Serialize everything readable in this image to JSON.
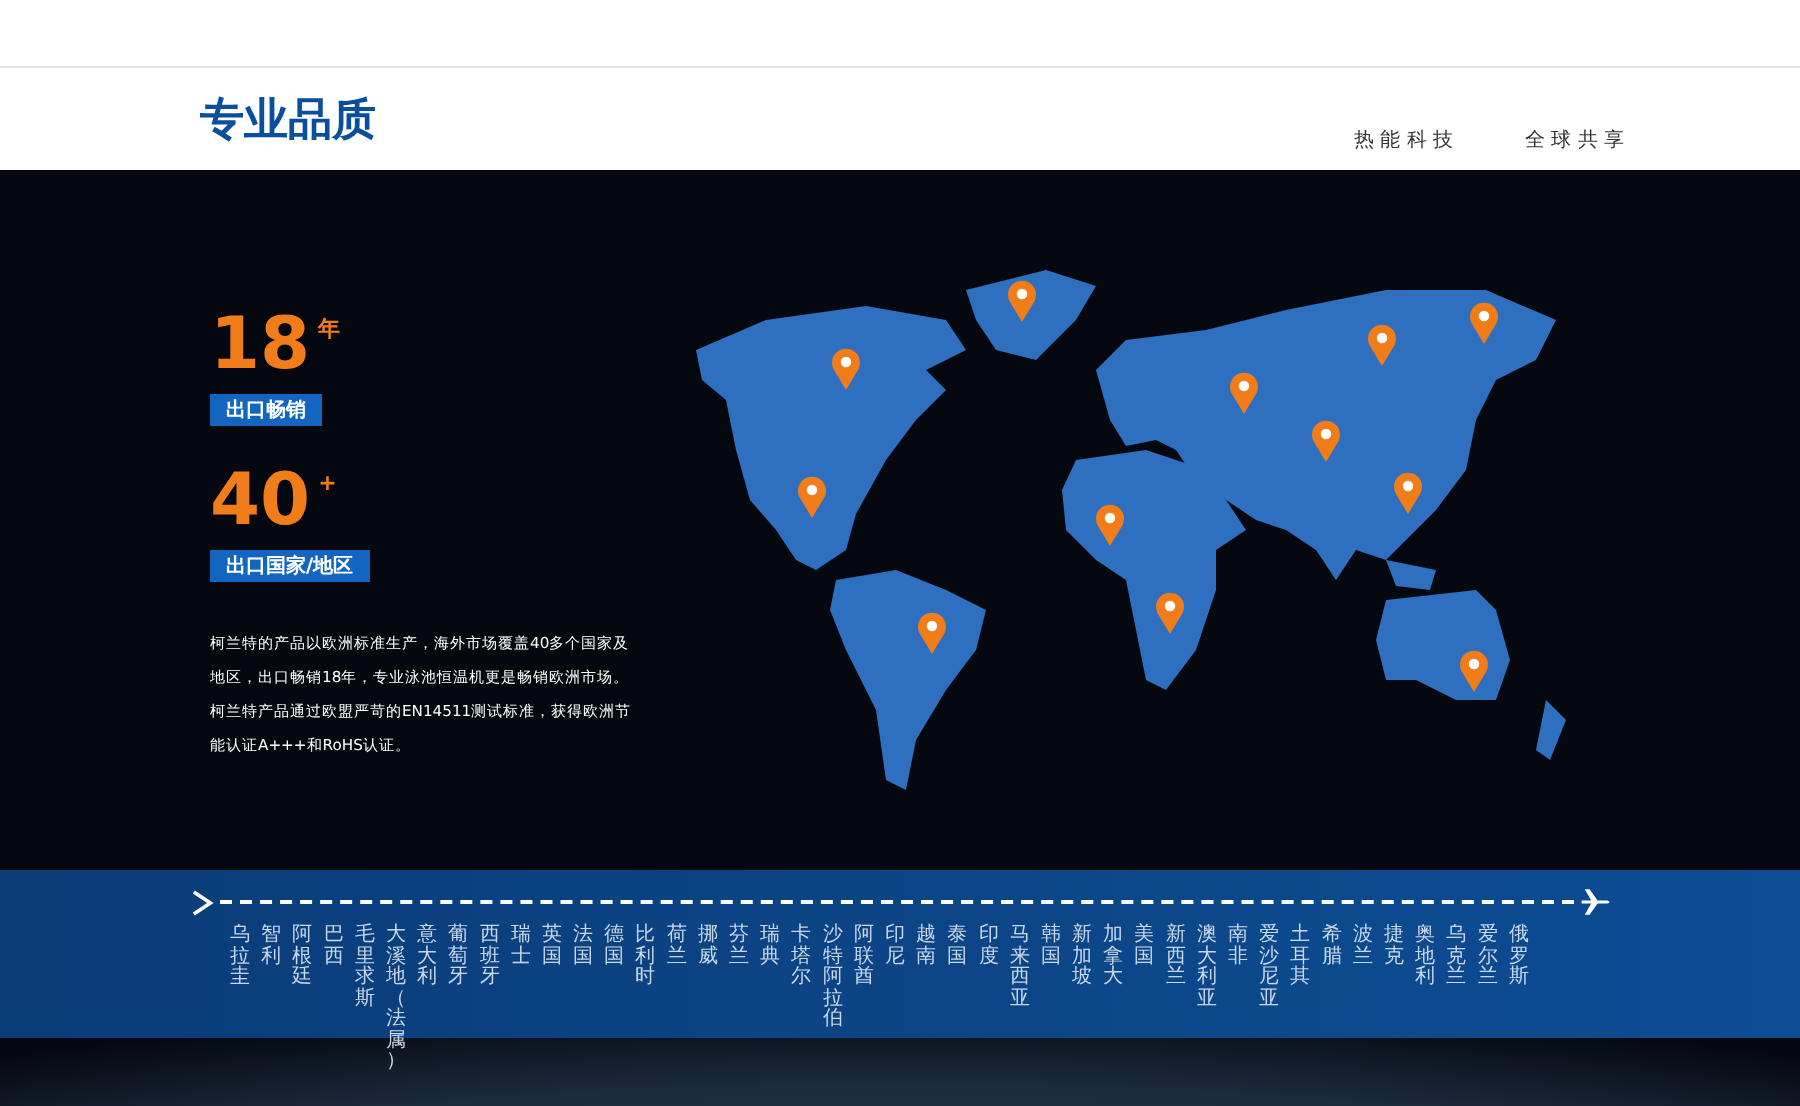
{
  "header": {
    "title": "专业品质",
    "slogans": [
      "热 能 科 技",
      "全 球 共 享"
    ]
  },
  "stats": [
    {
      "number": "18",
      "suffix": "年",
      "label": "出口畅销"
    },
    {
      "number": "40",
      "suffix": "+",
      "label": "出口国家/地区"
    }
  ],
  "description": "柯兰特的产品以欧洲标准生产，海外市场覆盖40多个国家及地区，出口畅销18年，专业泳池恒温机更是畅销欧洲市场。柯兰特产品通过欧盟严苛的EN14511测试标准，获得欧洲节能认证A+++和RoHS认证。",
  "countries": [
    "乌拉圭",
    "智利",
    "阿根廷",
    "巴西",
    "毛里求斯",
    "大溪地（法属）",
    "意大利",
    "葡萄牙",
    "西班牙",
    "瑞士",
    "英国",
    "法国",
    "德国",
    "比利时",
    "荷兰",
    "挪威",
    "芬兰",
    "瑞典",
    "卡塔尔",
    "沙特阿拉伯",
    "阿联酋",
    "印尼",
    "越南",
    "泰国",
    "印度",
    "马来西亚",
    "韩国",
    "新加坡",
    "加拿大",
    "美国",
    "新西兰",
    "澳大利亚",
    "南非",
    "爱沙尼亚",
    "土耳其",
    "希腊",
    "波兰",
    "捷克",
    "奥地利",
    "乌克兰",
    "爱尔兰",
    "俄罗斯"
  ]
}
